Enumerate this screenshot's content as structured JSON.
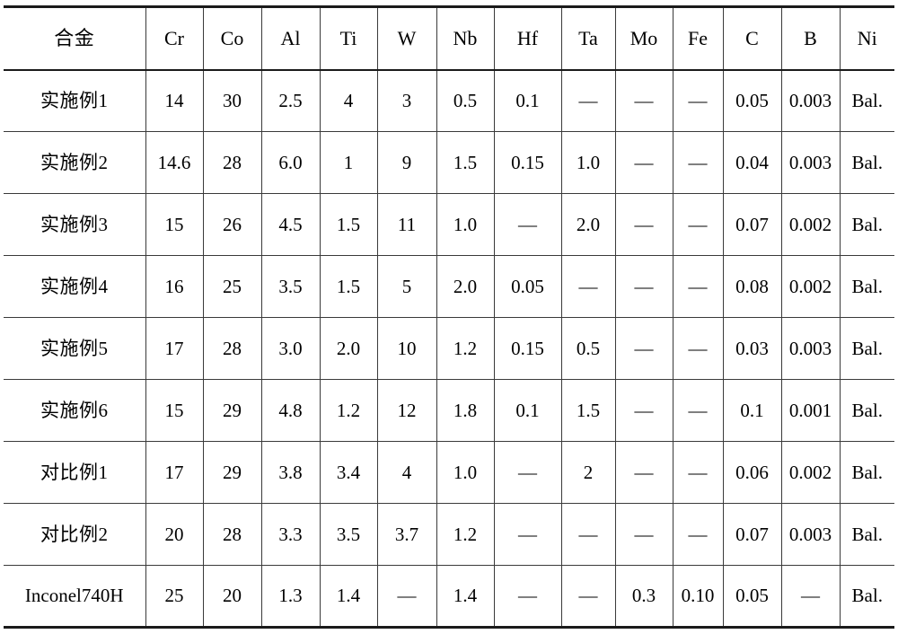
{
  "table": {
    "columns": [
      {
        "key": "name",
        "label": "合金"
      },
      {
        "key": "cr",
        "label": "Cr"
      },
      {
        "key": "co",
        "label": "Co"
      },
      {
        "key": "al",
        "label": "Al"
      },
      {
        "key": "ti",
        "label": "Ti"
      },
      {
        "key": "w",
        "label": "W"
      },
      {
        "key": "nb",
        "label": "Nb"
      },
      {
        "key": "hf",
        "label": "Hf"
      },
      {
        "key": "ta",
        "label": "Ta"
      },
      {
        "key": "mo",
        "label": "Mo"
      },
      {
        "key": "fe",
        "label": "Fe"
      },
      {
        "key": "c",
        "label": "C"
      },
      {
        "key": "b",
        "label": "B"
      },
      {
        "key": "ni",
        "label": "Ni"
      }
    ],
    "dash": "—",
    "rows": [
      {
        "name": "实施例1",
        "cr": "14",
        "co": "30",
        "al": "2.5",
        "ti": "4",
        "w": "3",
        "nb": "0.5",
        "hf": "0.1",
        "ta": "—",
        "mo": "—",
        "fe": "—",
        "c": "0.05",
        "b": "0.003",
        "ni": "Bal."
      },
      {
        "name": "实施例2",
        "cr": "14.6",
        "co": "28",
        "al": "6.0",
        "ti": "1",
        "w": "9",
        "nb": "1.5",
        "hf": "0.15",
        "ta": "1.0",
        "mo": "—",
        "fe": "—",
        "c": "0.04",
        "b": "0.003",
        "ni": "Bal."
      },
      {
        "name": "实施例3",
        "cr": "15",
        "co": "26",
        "al": "4.5",
        "ti": "1.5",
        "w": "11",
        "nb": "1.0",
        "hf": "—",
        "ta": "2.0",
        "mo": "—",
        "fe": "—",
        "c": "0.07",
        "b": "0.002",
        "ni": "Bal."
      },
      {
        "name": "实施例4",
        "cr": "16",
        "co": "25",
        "al": "3.5",
        "ti": "1.5",
        "w": "5",
        "nb": "2.0",
        "hf": "0.05",
        "ta": "—",
        "mo": "—",
        "fe": "—",
        "c": "0.08",
        "b": "0.002",
        "ni": "Bal."
      },
      {
        "name": "实施例5",
        "cr": "17",
        "co": "28",
        "al": "3.0",
        "ti": "2.0",
        "w": "10",
        "nb": "1.2",
        "hf": "0.15",
        "ta": "0.5",
        "mo": "—",
        "fe": "—",
        "c": "0.03",
        "b": "0.003",
        "ni": "Bal."
      },
      {
        "name": "实施例6",
        "cr": "15",
        "co": "29",
        "al": "4.8",
        "ti": "1.2",
        "w": "12",
        "nb": "1.8",
        "hf": "0.1",
        "ta": "1.5",
        "mo": "—",
        "fe": "—",
        "c": "0.1",
        "b": "0.001",
        "ni": "Bal."
      },
      {
        "name": "对比例1",
        "cr": "17",
        "co": "29",
        "al": "3.8",
        "ti": "3.4",
        "w": "4",
        "nb": "1.0",
        "hf": "—",
        "ta": "2",
        "mo": "—",
        "fe": "—",
        "c": "0.06",
        "b": "0.002",
        "ni": "Bal."
      },
      {
        "name": "对比例2",
        "cr": "20",
        "co": "28",
        "al": "3.3",
        "ti": "3.5",
        "w": "3.7",
        "nb": "1.2",
        "hf": "—",
        "ta": "—",
        "mo": "—",
        "fe": "—",
        "c": "0.07",
        "b": "0.003",
        "ni": "Bal."
      },
      {
        "name": "Inconel740H",
        "cr": "25",
        "co": "20",
        "al": "1.3",
        "ti": "1.4",
        "w": "—",
        "nb": "1.4",
        "hf": "—",
        "ta": "—",
        "mo": "0.3",
        "fe": "0.10",
        "c": "0.05",
        "b": "—",
        "ni": "Bal."
      }
    ]
  }
}
